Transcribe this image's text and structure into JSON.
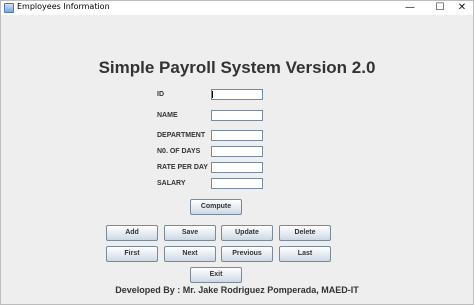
{
  "window": {
    "title": "Employees Information",
    "controls": {
      "minimize": "—",
      "maximize": "☐",
      "close": "✕"
    }
  },
  "heading": "Simple Payroll System Version 2.0",
  "fields": [
    {
      "label": "ID",
      "value": ""
    },
    {
      "label": "NAME",
      "value": ""
    },
    {
      "label": "DEPARTMENT",
      "value": ""
    },
    {
      "label": "N0. OF DAYS",
      "value": ""
    },
    {
      "label": "RATE PER DAY",
      "value": ""
    },
    {
      "label": "SALARY",
      "value": ""
    }
  ],
  "buttons": {
    "compute": "Compute",
    "add": "Add",
    "save": "Save",
    "update": "Update",
    "delete": "Delete",
    "first": "First",
    "next": "Next",
    "previous": "Previous",
    "last": "Last",
    "exit": "Exit"
  },
  "footer": "Developed By : Mr. Jake Rodriguez Pomperada, MAED-IT",
  "colors": {
    "window_bg": "#eeeeee",
    "text": "#333333",
    "button_border": "#7a8a99"
  }
}
